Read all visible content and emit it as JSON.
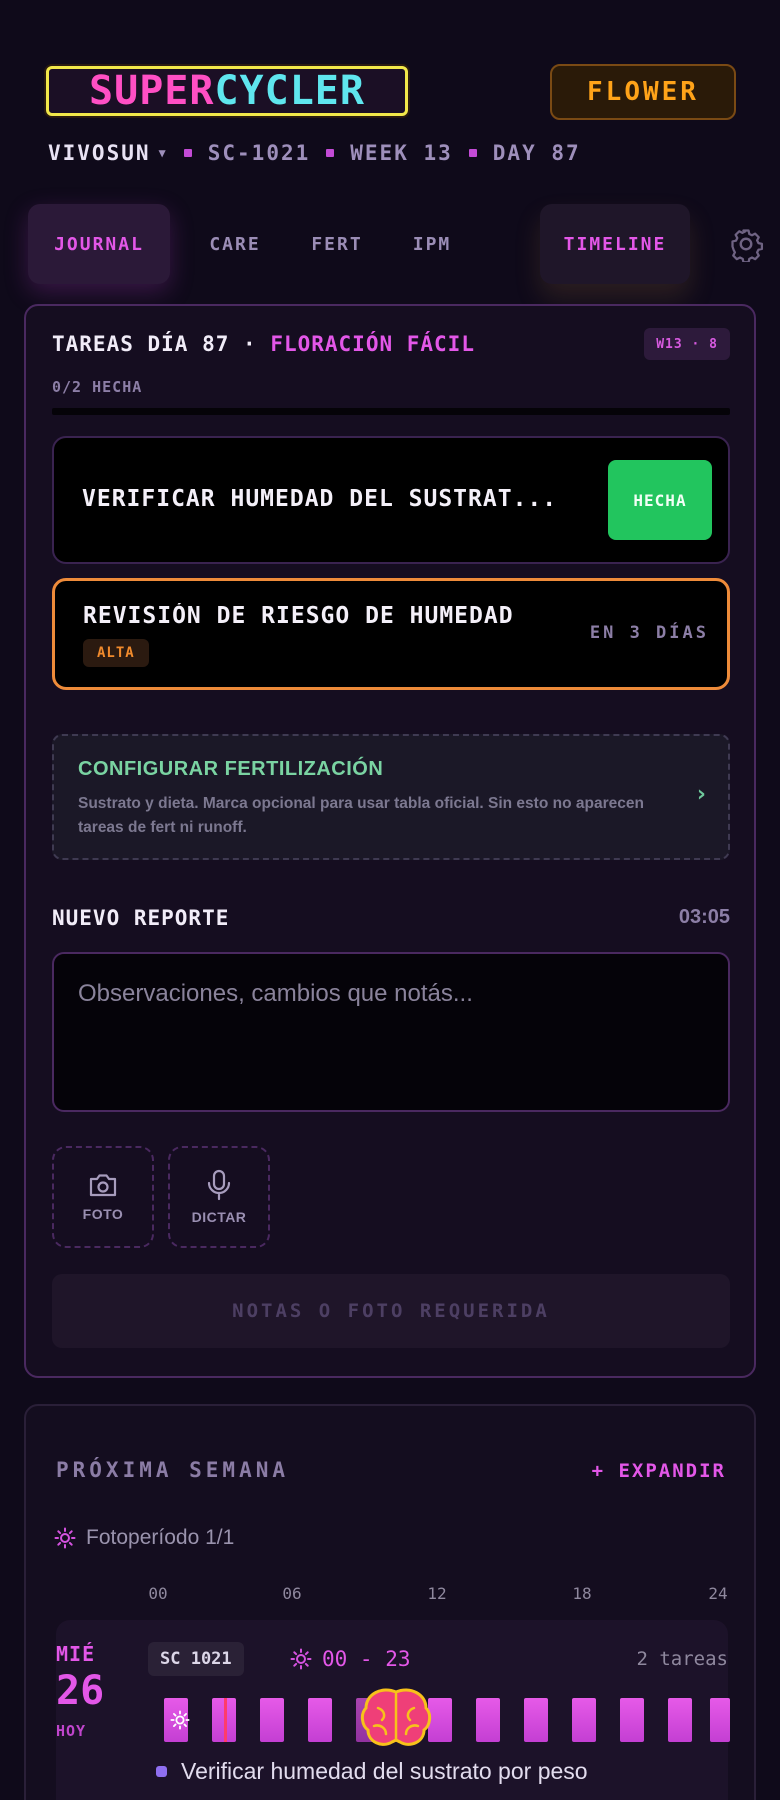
{
  "header": {
    "logo_part1": "SUPER",
    "logo_part2": "CYCLER",
    "stage": "FLOWER",
    "brand": "VIVOSUN",
    "plant_id": "SC-1021",
    "week": "WEEK 13",
    "day": "DAY 87"
  },
  "tabs": [
    {
      "label": "JOURNAL",
      "active": true
    },
    {
      "label": "CARE"
    },
    {
      "label": "FERT"
    },
    {
      "label": "IPM"
    },
    {
      "label": "TIMELINE"
    }
  ],
  "tasks_card": {
    "title_prefix": "TAREAS DÍA 87 ·",
    "title_highlight": "FLORACIÓN FÁCIL",
    "badge": "W13 · 8",
    "progress_label": "0/2 HECHA",
    "progress_fraction": 0,
    "tasks": [
      {
        "name": "VERIFICAR HUMEDAD DEL SUSTRAT...",
        "action": "HECHA"
      },
      {
        "name": "REVISIÓN DE RIESGO DE HUMEDAD",
        "priority": "ALTA",
        "due": "EN 3 DÍAS"
      }
    ],
    "fert": {
      "title": "CONFIGURAR FERTILIZACIÓN",
      "desc": "Sustrato y dieta. Marca opcional para usar tabla oficial. Sin esto no aparecen tareas de fert ni runoff.",
      "chevron": "›"
    },
    "report": {
      "title": "NUEVO REPORTE",
      "time": "03:05",
      "placeholder": "Observaciones, cambios que notás...",
      "photo_label": "FOTO",
      "dictate_label": "DICTAR",
      "submit_label": "NOTAS O FOTO REQUERIDA"
    }
  },
  "next_week": {
    "title": "PRÓXIMA SEMANA",
    "expand": "+ EXPANDIR",
    "photoperiod": "Fotoperíodo 1/1",
    "hours": [
      "00",
      "06",
      "12",
      "18",
      "24"
    ],
    "day": {
      "name": "MIÉ",
      "number": "26",
      "today": "HOY",
      "plant": "SC 1021",
      "light_range": "00 - 23",
      "task_count": "2 tareas",
      "first_task": "Verificar humedad del sustrato por peso"
    }
  },
  "colors": {
    "accent": "#e357e8",
    "stage": "#ffa319",
    "done": "#22c55e",
    "priority_high": "#ee8b3a",
    "fert": "#7ad3a2"
  }
}
